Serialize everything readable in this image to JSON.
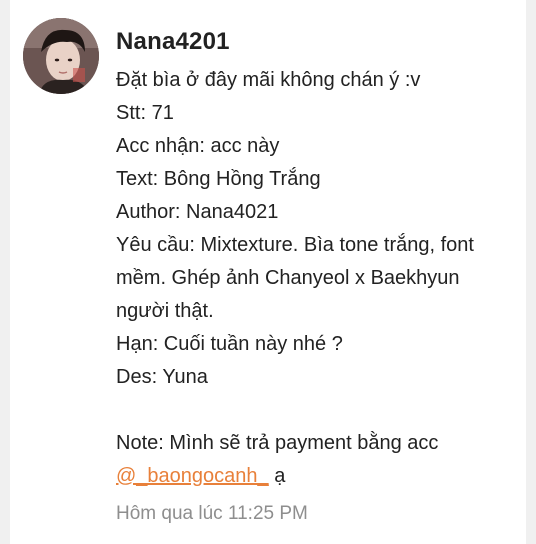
{
  "message": {
    "username": "Nana4201",
    "lines": [
      "Đặt bìa ở đây mãi không chán ý :v",
      "Stt: 71",
      "Acc nhận: acc này",
      "Text: Bông Hồng Trắng",
      "Author: Nana4021",
      "Yêu cầu: Mixtexture. Bìa tone trắng, font mềm. Ghép ảnh Chanyeol x Baekhyun người thật.",
      "Hạn: Cuối tuần này nhé ?",
      "Des: Yuna"
    ],
    "note_line": "Note: Mình sẽ trả payment bằng acc",
    "mention": "@_baongocanh_",
    "mention_suffix": " ạ",
    "timestamp": "Hôm qua lúc 11:25 PM"
  },
  "colors": {
    "mention": "#e8803a",
    "timestamp": "#8e8e8e",
    "text": "#222222"
  },
  "icons": {
    "avatar": "user-avatar-photo"
  }
}
